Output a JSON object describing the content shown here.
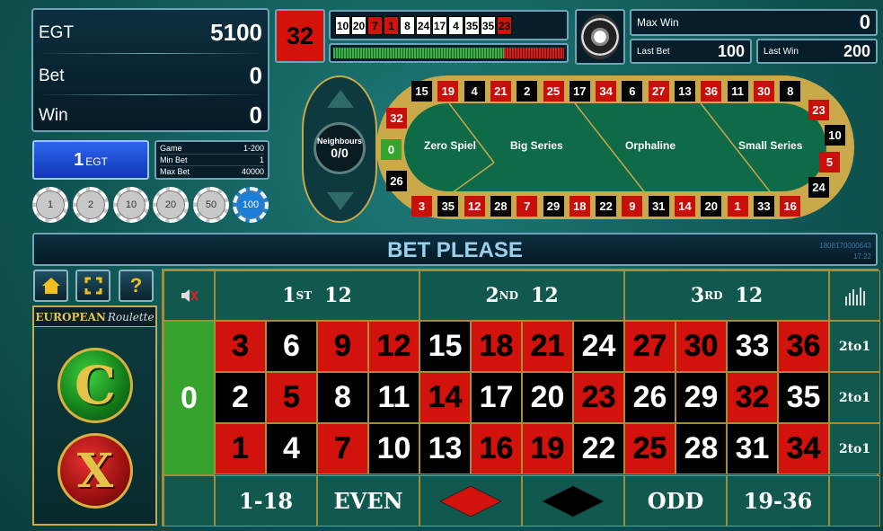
{
  "stats": {
    "balance_label": "EGT",
    "balance_value": "5100",
    "bet_label": "Bet",
    "bet_value": "0",
    "win_label": "Win",
    "win_value": "0"
  },
  "last_number": "32",
  "history": [
    {
      "n": "10",
      "c": "black"
    },
    {
      "n": "20",
      "c": "black"
    },
    {
      "n": "7",
      "c": "red"
    },
    {
      "n": "1",
      "c": "red"
    },
    {
      "n": "8",
      "c": "black"
    },
    {
      "n": "24",
      "c": "black"
    },
    {
      "n": "17",
      "c": "black"
    },
    {
      "n": "4",
      "c": "black"
    },
    {
      "n": "35",
      "c": "black"
    },
    {
      "n": "35",
      "c": "black"
    },
    {
      "n": "23",
      "c": "red"
    }
  ],
  "top_right": {
    "max_win_label": "Max Win",
    "max_win_value": "0",
    "last_bet_label": "Last Bet",
    "last_bet_value": "100",
    "last_win_label": "Last Win",
    "last_win_value": "200"
  },
  "denomination": {
    "value": "1",
    "unit": "EGT"
  },
  "game_info": {
    "game_label": "Game",
    "game_value": "1-200",
    "min_label": "Min Bet",
    "min_value": "1",
    "max_label": "Max Bet",
    "max_value": "40000"
  },
  "chips": [
    "1",
    "2",
    "10",
    "20",
    "50",
    "100"
  ],
  "neighbours": {
    "label": "Neighbours",
    "value": "0/0"
  },
  "racetrack": {
    "sections": [
      "Zero Spiel",
      "Big Series",
      "Orphaline",
      "Small Series"
    ],
    "top": [
      {
        "n": "15",
        "c": "black"
      },
      {
        "n": "19",
        "c": "red"
      },
      {
        "n": "4",
        "c": "black"
      },
      {
        "n": "21",
        "c": "red"
      },
      {
        "n": "2",
        "c": "black"
      },
      {
        "n": "25",
        "c": "red"
      },
      {
        "n": "17",
        "c": "black"
      },
      {
        "n": "34",
        "c": "red"
      },
      {
        "n": "6",
        "c": "black"
      },
      {
        "n": "27",
        "c": "red"
      },
      {
        "n": "13",
        "c": "black"
      },
      {
        "n": "36",
        "c": "red"
      },
      {
        "n": "11",
        "c": "black"
      },
      {
        "n": "30",
        "c": "red"
      },
      {
        "n": "8",
        "c": "black"
      }
    ],
    "bottom": [
      {
        "n": "3",
        "c": "red"
      },
      {
        "n": "35",
        "c": "black"
      },
      {
        "n": "12",
        "c": "red"
      },
      {
        "n": "28",
        "c": "black"
      },
      {
        "n": "7",
        "c": "red"
      },
      {
        "n": "29",
        "c": "black"
      },
      {
        "n": "18",
        "c": "red"
      },
      {
        "n": "22",
        "c": "black"
      },
      {
        "n": "9",
        "c": "red"
      },
      {
        "n": "31",
        "c": "black"
      },
      {
        "n": "14",
        "c": "red"
      },
      {
        "n": "20",
        "c": "black"
      },
      {
        "n": "1",
        "c": "red"
      },
      {
        "n": "33",
        "c": "black"
      },
      {
        "n": "16",
        "c": "red"
      }
    ],
    "left": [
      {
        "n": "32",
        "c": "red"
      },
      {
        "n": "0",
        "c": "green"
      },
      {
        "n": "26",
        "c": "black"
      }
    ],
    "right": [
      {
        "n": "23",
        "c": "red"
      },
      {
        "n": "10",
        "c": "black"
      },
      {
        "n": "5",
        "c": "red"
      },
      {
        "n": "24",
        "c": "black"
      }
    ]
  },
  "status": {
    "message": "BET PLEASE",
    "id": "1808170000643",
    "time": "17:22"
  },
  "logo": {
    "word1": "EUROPEAN",
    "word2": "Roulette"
  },
  "table": {
    "dozens": [
      {
        "num": "1",
        "sup": "ST",
        "val": "12"
      },
      {
        "num": "2",
        "sup": "ND",
        "val": "12"
      },
      {
        "num": "3",
        "sup": "RD",
        "val": "12"
      }
    ],
    "zero": "0",
    "rows": [
      [
        {
          "n": "3",
          "c": "red"
        },
        {
          "n": "6",
          "c": "black"
        },
        {
          "n": "9",
          "c": "red"
        },
        {
          "n": "12",
          "c": "red"
        },
        {
          "n": "15",
          "c": "black"
        },
        {
          "n": "18",
          "c": "red"
        },
        {
          "n": "21",
          "c": "red"
        },
        {
          "n": "24",
          "c": "black"
        },
        {
          "n": "27",
          "c": "red"
        },
        {
          "n": "30",
          "c": "red"
        },
        {
          "n": "33",
          "c": "black"
        },
        {
          "n": "36",
          "c": "red"
        }
      ],
      [
        {
          "n": "2",
          "c": "black"
        },
        {
          "n": "5",
          "c": "red"
        },
        {
          "n": "8",
          "c": "black"
        },
        {
          "n": "11",
          "c": "black"
        },
        {
          "n": "14",
          "c": "red"
        },
        {
          "n": "17",
          "c": "black"
        },
        {
          "n": "20",
          "c": "black"
        },
        {
          "n": "23",
          "c": "red"
        },
        {
          "n": "26",
          "c": "black"
        },
        {
          "n": "29",
          "c": "black"
        },
        {
          "n": "32",
          "c": "red"
        },
        {
          "n": "35",
          "c": "black"
        }
      ],
      [
        {
          "n": "1",
          "c": "red"
        },
        {
          "n": "4",
          "c": "black"
        },
        {
          "n": "7",
          "c": "red"
        },
        {
          "n": "10",
          "c": "black"
        },
        {
          "n": "13",
          "c": "black"
        },
        {
          "n": "16",
          "c": "red"
        },
        {
          "n": "19",
          "c": "red"
        },
        {
          "n": "22",
          "c": "black"
        },
        {
          "n": "25",
          "c": "red"
        },
        {
          "n": "28",
          "c": "black"
        },
        {
          "n": "31",
          "c": "black"
        },
        {
          "n": "34",
          "c": "red"
        }
      ]
    ],
    "columns": [
      "2to1",
      "2to1",
      "2to1"
    ],
    "outside": [
      "1-18",
      "EVEN",
      "",
      "",
      "ODD",
      "19-36"
    ]
  },
  "colors": {
    "red": "#d2120c",
    "black": "#000000",
    "felt": "#11594f",
    "gold": "#a58c37",
    "accent_blue": "#1a4fd8"
  }
}
